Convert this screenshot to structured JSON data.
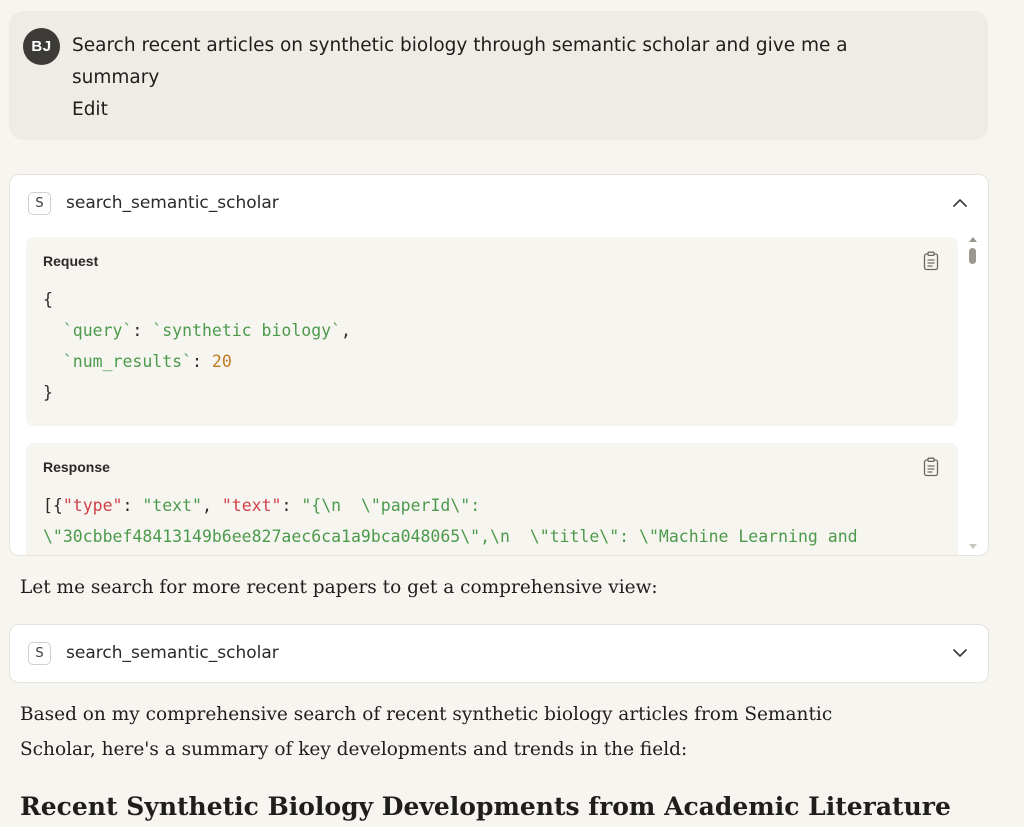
{
  "user_message": {
    "avatar_initials": "BJ",
    "text_line1": "Search recent articles on synthetic biology through semantic scholar and give me a",
    "text_line2": "summary",
    "edit_label": "Edit"
  },
  "tool_call_1": {
    "badge": "S",
    "name": "search_semantic_scholar",
    "state": "expanded",
    "request_label": "Request",
    "request_code": {
      "open": "{",
      "line1_key": "  `query`",
      "line1_colon": ": ",
      "line1_value": "`synthetic biology`",
      "line1_comma": ",",
      "line2_key": "  `num_results`",
      "line2_colon": ": ",
      "line2_value": "20",
      "close": "}"
    },
    "response_label": "Response",
    "response_code": {
      "line1_a": "[{",
      "line1_b": "\"type\"",
      "line1_c": ": ",
      "line1_d": "\"text\"",
      "line1_e": ", ",
      "line1_f": "\"text\"",
      "line1_g": ": ",
      "line1_h": "\"{\\n  \\\"paperId\\\":",
      "line2": "\\\"30cbbef48413149b6ee827aec6ca1a9bca048065\\\",\\n  \\\"title\\\": \\\"Machine Learning and"
    }
  },
  "assistant_text_1": "Let me search for more recent papers to get a comprehensive view:",
  "tool_call_2": {
    "badge": "S",
    "name": "search_semantic_scholar",
    "state": "collapsed"
  },
  "assistant_text_2_line1": "Based on my comprehensive search of recent synthetic biology articles from Semantic",
  "assistant_text_2_line2": "Scholar, here's a summary of key developments and trends in the field:",
  "heading": "Recent Synthetic Biology Developments from Academic Literature",
  "colors": {
    "background": "#f7f5f0",
    "user_bubble": "#efece5",
    "code_green": "#4c9a4c",
    "code_red": "#d1404a",
    "code_number": "#c07a20"
  }
}
